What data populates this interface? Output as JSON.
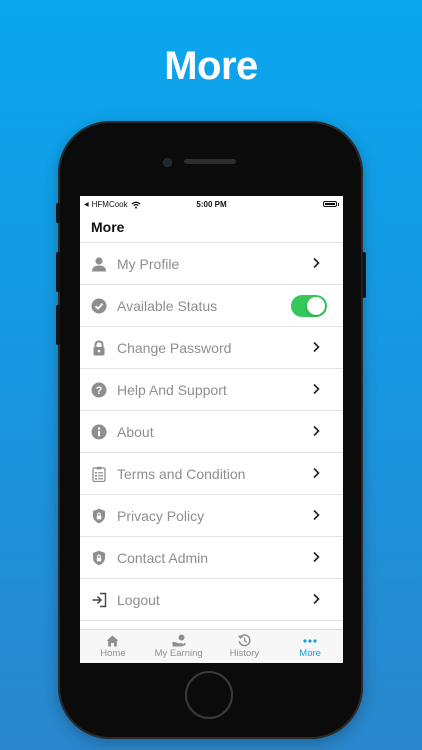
{
  "headline": "More",
  "status_bar": {
    "carrier": "HFMCook",
    "time": "5:00 PM"
  },
  "screen_title": "More",
  "menu": [
    {
      "label": "My Profile",
      "icon": "person-icon",
      "control": "chevron"
    },
    {
      "label": "Available Status",
      "icon": "check-circle-icon",
      "control": "toggle",
      "toggle_on": true
    },
    {
      "label": "Change Password",
      "icon": "lock-icon",
      "control": "chevron"
    },
    {
      "label": "Help And Support",
      "icon": "question-circle-icon",
      "control": "chevron"
    },
    {
      "label": "About",
      "icon": "info-circle-icon",
      "control": "chevron"
    },
    {
      "label": "Terms and Condition",
      "icon": "clipboard-list-icon",
      "control": "chevron"
    },
    {
      "label": "Privacy Policy",
      "icon": "shield-lock-icon",
      "control": "chevron"
    },
    {
      "label": "Contact Admin",
      "icon": "shield-lock-icon",
      "control": "chevron"
    },
    {
      "label": "Logout",
      "icon": "logout-icon",
      "control": "chevron"
    }
  ],
  "tabs": [
    {
      "label": "Home",
      "icon": "home-icon",
      "active": false
    },
    {
      "label": "My Earning",
      "icon": "earning-icon",
      "active": false
    },
    {
      "label": "History",
      "icon": "history-icon",
      "active": false
    },
    {
      "label": "More",
      "icon": "more-dots-icon",
      "active": true
    }
  ],
  "colors": {
    "background_top": "#0aa6ee",
    "background_bottom": "#2a86cc",
    "toggle_on": "#34c759",
    "active_tab": "#1a9be2",
    "menu_text": "#8e8e8e"
  }
}
